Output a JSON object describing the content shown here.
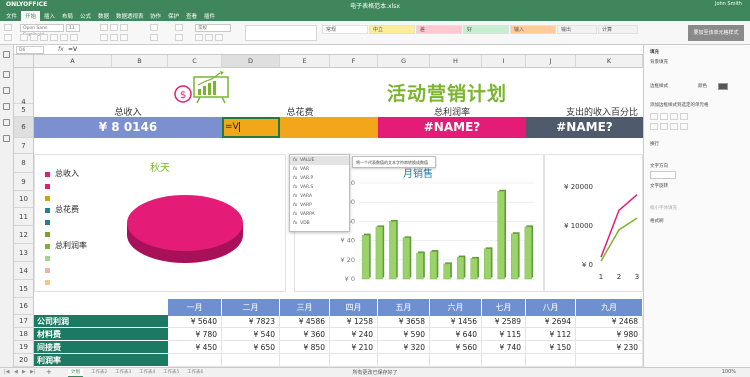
{
  "titlebar": {
    "logo": "ONLYOFFICE",
    "doc_title": "电子表格范本.xlsx",
    "user": "John Smith"
  },
  "menu": {
    "tabs": [
      "文件",
      "开始",
      "插入",
      "布局",
      "公式",
      "数据",
      "数据透视表",
      "协作",
      "保护",
      "查看",
      "插件"
    ],
    "active": 1
  },
  "toolbar": {
    "font_name": "Open Sans Semibold",
    "font_size": "11",
    "number_format": "常规",
    "styles": [
      {
        "label": "常规",
        "bg": "#ffffff"
      },
      {
        "label": "中立",
        "bg": "#ffeb9c"
      },
      {
        "label": "差",
        "bg": "#ffc7ce"
      },
      {
        "label": "好",
        "bg": "#c6efce"
      },
      {
        "label": "输入",
        "bg": "#ffcc99"
      },
      {
        "label": "输出",
        "bg": "#f2f2f2"
      },
      {
        "label": "计算",
        "bg": "#f2f2f2"
      }
    ],
    "style_prev": "",
    "styles_label": "要加至该单元格样式",
    "left_button": "",
    "btn_format": ""
  },
  "formula": {
    "name_box": "D6",
    "fx": "fx",
    "value": "=V"
  },
  "columns": [
    "A",
    "B",
    "C",
    "D",
    "E",
    "F",
    "G",
    "H",
    "I",
    "J",
    "K"
  ],
  "rows": [
    "4",
    "5",
    "6",
    "7",
    "8",
    "9",
    "10",
    "11",
    "12",
    "13",
    "14",
    "15",
    "16",
    "17",
    "18",
    "19",
    "20"
  ],
  "sheet": {
    "title": "活动营销计划",
    "labels": {
      "income": "总收入",
      "spend": "总花费",
      "profit": "总利润率",
      "pct": "支出的收入百分比"
    },
    "values": {
      "income": "¥ 8 0146",
      "spend": "=V",
      "profit": "#NAME?",
      "pct": "#NAME?"
    },
    "colors": {
      "income": "#7b8fd1",
      "spend": "#f2a61a",
      "profit": "#e41c77",
      "pct": "#4f5b6d",
      "title": "#7bb52f"
    }
  },
  "autocomplete": {
    "items": [
      "VALUE",
      "VAR",
      "VAR.P",
      "VAR.S",
      "VARA",
      "VARP",
      "VARPA",
      "VDB"
    ],
    "selected": 0,
    "tooltip": "将一个代表数值的文本字符串转换成数值",
    "fx_prefix": "fx"
  },
  "pie_legend": {
    "title": "秋天",
    "items": [
      {
        "label": "总收入",
        "color": "#e41c77"
      },
      {
        "label": "",
        "color": "#e41c77"
      },
      {
        "label": "",
        "color": "#d4a000"
      },
      {
        "label": "总花费",
        "color": "#1f7f9d"
      },
      {
        "label": "",
        "color": "#1f7f9d"
      },
      {
        "label": "",
        "color": "#7ba22c"
      },
      {
        "label": "总利润率",
        "color": "#7bb52f"
      },
      {
        "label": "",
        "color": "#9fd88a"
      },
      {
        "label": "",
        "color": "#f3b0a5"
      },
      {
        "label": "",
        "color": "#f5c58a"
      }
    ]
  },
  "chart_data": [
    {
      "type": "bar",
      "title": "月销售",
      "series": [
        {
          "name": "",
          "values": [
            3200,
            3800,
            4200,
            3000,
            1900,
            2000,
            1100,
            1600,
            1500,
            2200,
            6400,
            3300,
            3800
          ]
        }
      ],
      "y_ticks": [
        "¥ 0",
        "¥ 20",
        "¥ 40",
        "¥ 60",
        "¥ 80",
        "¥ 10"
      ],
      "ylim": [
        0,
        7000
      ]
    },
    {
      "type": "line",
      "x": [
        "1",
        "2",
        "3"
      ],
      "y_ticks": [
        "¥ 0",
        "¥ 10000",
        "¥ 20000"
      ],
      "series": [
        {
          "name": "",
          "values": [
            2000,
            14000,
            18000
          ],
          "color": "#e41c77"
        },
        {
          "name": "",
          "values": [
            1000,
            9000,
            12000
          ],
          "color": "#7bb52f"
        }
      ],
      "ylim": [
        0,
        22000
      ]
    }
  ],
  "table": {
    "months": [
      "一月",
      "二月",
      "三月",
      "四月",
      "五月",
      "六月",
      "七月",
      "八月",
      "九月"
    ],
    "rows": [
      {
        "label": "公司利润",
        "values": [
          "¥ 5640",
          "¥ 7823",
          "¥ 4586",
          "¥ 1258",
          "¥ 3658",
          "¥ 1456",
          "¥ 2589",
          "¥ 2694",
          "¥ 2468"
        ]
      },
      {
        "label": "材料费",
        "values": [
          "¥ 780",
          "¥ 540",
          "¥ 360",
          "¥ 240",
          "¥ 590",
          "¥ 640",
          "¥ 115",
          "¥ 112",
          "¥ 980"
        ]
      },
      {
        "label": "间接费",
        "values": [
          "¥ 450",
          "¥ 650",
          "¥ 850",
          "¥ 210",
          "¥ 320",
          "¥ 560",
          "¥ 740",
          "¥ 150",
          "¥ 230"
        ]
      },
      {
        "label": "利润率",
        "values": [
          "",
          "",
          "",
          "",
          "",
          "",
          "",
          "",
          ""
        ]
      }
    ]
  },
  "rightpanel": {
    "header": "填充",
    "fill_label": "背景填充",
    "fill_value": "",
    "color_label": "背景颜色",
    "color_hint": "颜色",
    "border_label": "边框样式",
    "border_sample": "",
    "border_hint": "添加边框样式到选定的单元格",
    "wrap_label": "换行",
    "orientation_label": "文字方向",
    "orientation_value": "",
    "angle_label": "文字旋转",
    "indent": "",
    "wrap_text_check": "缩小字体填充",
    "format_label": "格式刷",
    "format_btn": "",
    "toggle": ""
  },
  "sheets": {
    "items": [
      "计划",
      "工作表2",
      "工作表3",
      "工作表4",
      "工作表5",
      "工作表6"
    ],
    "active": 0,
    "status": "所有更改已保存好了",
    "zoom": "100%"
  }
}
